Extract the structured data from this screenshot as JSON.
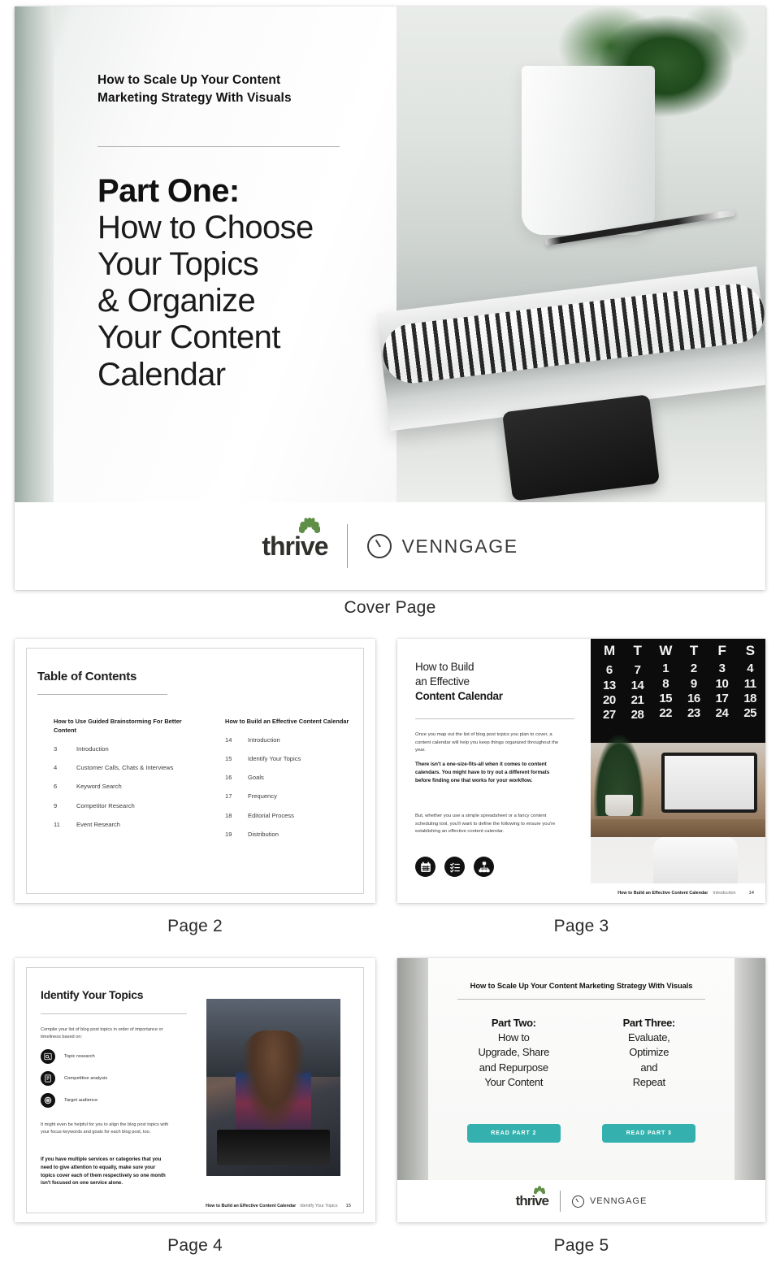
{
  "captions": {
    "cover": "Cover Page",
    "page2": "Page 2",
    "page3": "Page 3",
    "page4": "Page 4",
    "page5": "Page 5"
  },
  "brand": {
    "thrive": "thrive",
    "venngage": "VENNGAGE",
    "accent_teal": "#34b1ae",
    "tree_green": "#5f8f46"
  },
  "cover": {
    "kicker": "How to Scale Up Your Content Marketing Strategy With Visuals",
    "part_label": "Part One:",
    "title_line1": "How to Choose",
    "title_line2": "Your Topics",
    "title_line3": "& Organize",
    "title_line4": "Your Content",
    "title_line5": "Calendar"
  },
  "page2": {
    "title": "Table of Contents",
    "columns": [
      {
        "heading": "How to Use Guided Brainstorming For Better Content",
        "entries": [
          {
            "page": "3",
            "label": "Introduction"
          },
          {
            "page": "4",
            "label": "Customer Calls, Chats & Interviews"
          },
          {
            "page": "6",
            "label": "Keyword Search"
          },
          {
            "page": "9",
            "label": "Competitor Research"
          },
          {
            "page": "11",
            "label": "Event Research"
          }
        ]
      },
      {
        "heading": "How to Build an Effective Content Calendar",
        "entries": [
          {
            "page": "14",
            "label": "Introduction"
          },
          {
            "page": "15",
            "label": "Identify Your Topics"
          },
          {
            "page": "16",
            "label": "Goals"
          },
          {
            "page": "17",
            "label": "Frequency"
          },
          {
            "page": "18",
            "label": "Editorial Process"
          },
          {
            "page": "19",
            "label": "Distribution"
          }
        ]
      }
    ]
  },
  "page3": {
    "title_line1": "How to Build",
    "title_line2": "an Effective",
    "title_line3": "Content Calendar",
    "para1": "Once you map out the list of blog post topics you plan to cover, a content calendar will help you keep things organized throughout the year.",
    "para2_bold": "There isn't a one-size-fits-all when it comes to content calendars. You might have to try out a different formats before finding one that works for your workflow.",
    "para3": "But, whether you use a simple spreadsheet or a fancy content scheduling tool, you'll want to define the following to ensure you're establishing an effective content calendar.",
    "icons": [
      "calendar-icon",
      "checklist-icon",
      "sitemap-icon"
    ],
    "calendar_photo": {
      "headers": [
        "M",
        "T",
        "W",
        "T",
        "F",
        "S"
      ],
      "rows": [
        [
          "",
          "",
          "1",
          "2",
          "3",
          "4"
        ],
        [
          "6",
          "7",
          "8",
          "9",
          "10",
          "11"
        ],
        [
          "13",
          "14",
          "15",
          "16",
          "17",
          "18"
        ],
        [
          "20",
          "21",
          "22",
          "23",
          "24",
          "25"
        ],
        [
          "27",
          "28",
          "",
          "",
          "",
          ""
        ]
      ]
    },
    "footer_bold": "How to Build an Effective Content Calendar",
    "footer_light": "Introduction",
    "footer_page": "14"
  },
  "page4": {
    "title": "Identify Your Topics",
    "para1": "Compile your list of blog post topics in order of importance or timeliness based on:",
    "list": [
      {
        "icon": "topic-research-icon",
        "label": "Topic research"
      },
      {
        "icon": "competitive-analysis-icon",
        "label": "Competitive analysis"
      },
      {
        "icon": "target-audience-icon",
        "label": "Target audience"
      }
    ],
    "para2": "It might even be helpful for you to align the blog post topics with your focus keywords and goals for each blog post, too.",
    "para3_bold": "If you have multiple services or categories that you need to give attention to equally, make sure your topics cover each of them respectively so one month isn't focused on one service alone.",
    "footer_bold": "How to Build an Effective Content Calendar",
    "footer_light": "Identify Your Topics",
    "footer_page": "15"
  },
  "page5": {
    "kicker": "How to Scale Up Your Content Marketing Strategy With Visuals",
    "columns": [
      {
        "heading": "Part Two:",
        "line1": "How to",
        "line2": "Upgrade, Share",
        "line3": "and Repurpose",
        "line4": "Your Content",
        "button": "READ PART 2"
      },
      {
        "heading": "Part Three:",
        "line1": "Evaluate,",
        "line2": "Optimize",
        "line3": "and",
        "line4": "Repeat",
        "button": "READ PART 3"
      }
    ]
  }
}
